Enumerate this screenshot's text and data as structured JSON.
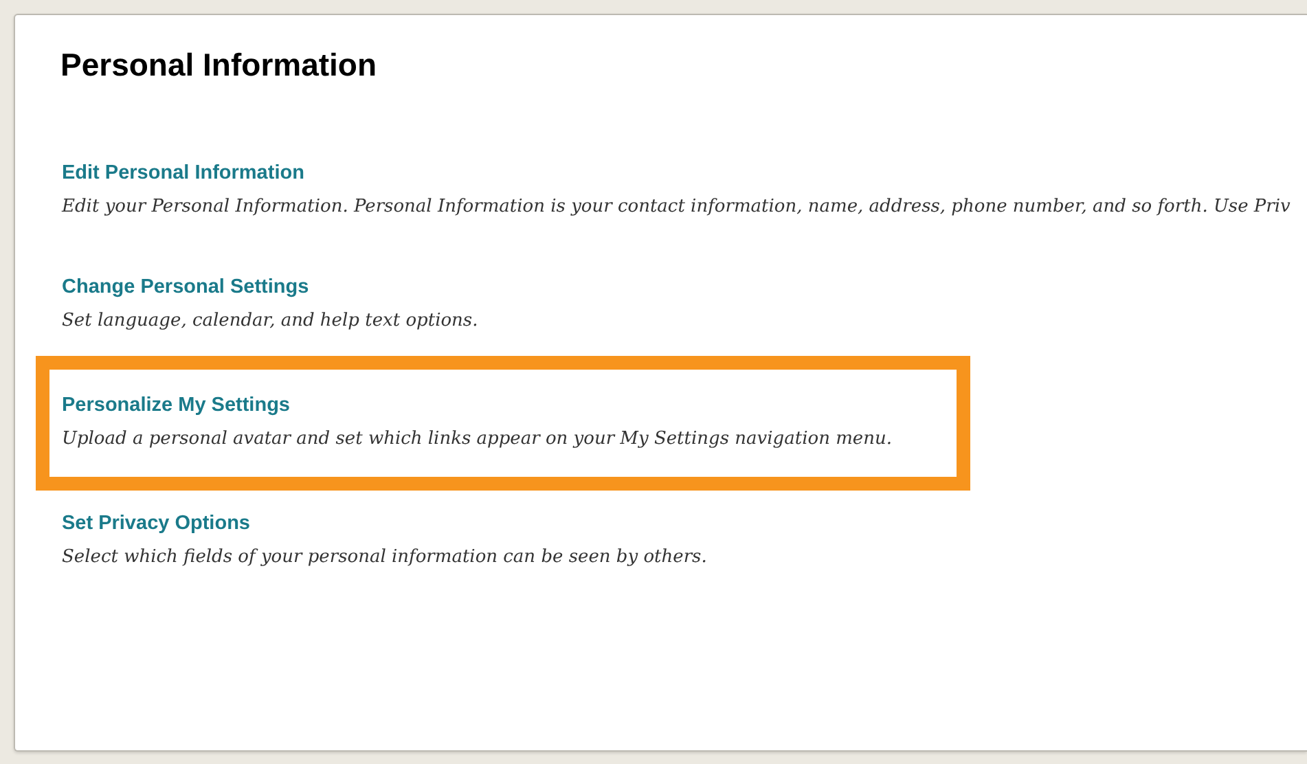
{
  "page": {
    "title": "Personal Information"
  },
  "options": [
    {
      "link": "Edit Personal Information",
      "description": "Edit your Personal Information. Personal Information is your contact information, name, address, phone number, and so forth. Use Priv",
      "highlighted": false
    },
    {
      "link": "Change Personal Settings",
      "description": "Set language, calendar, and help text options.",
      "highlighted": false
    },
    {
      "link": "Personalize My Settings",
      "description": "Upload a personal avatar and set which links appear on your My Settings navigation menu.",
      "highlighted": true
    },
    {
      "link": "Set Privacy Options",
      "description": "Select which fields of your personal information can be seen by others.",
      "highlighted": false
    }
  ]
}
